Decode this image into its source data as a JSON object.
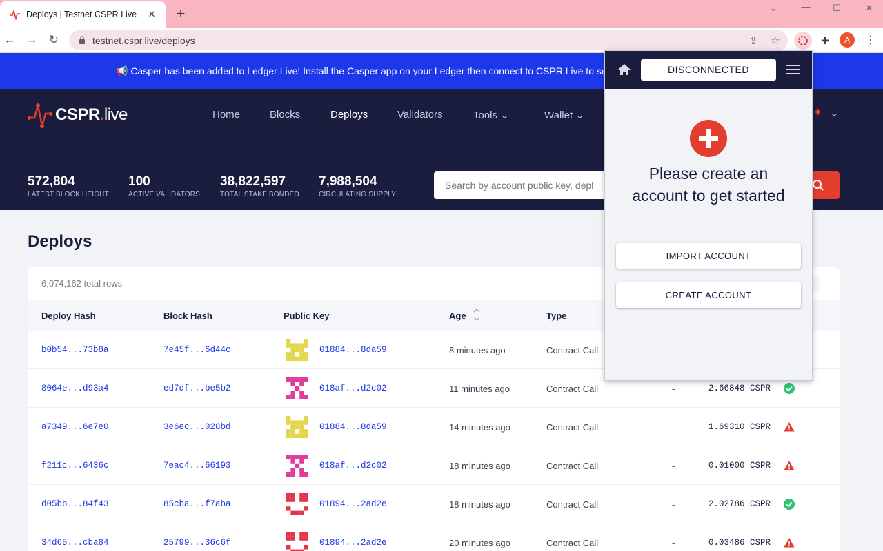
{
  "browser": {
    "tab_title": "Deploys | Testnet CSPR Live",
    "tab_close": "✕",
    "new_tab": "+",
    "url": "testnet.cspr.live/deploys",
    "profile_initial": "A"
  },
  "announcement": {
    "text": "📢 Casper has been added to Ledger Live! Install the Casper app on your Ledger then connect to CSPR.Live to secu"
  },
  "header": {
    "logo_main": "CSPR",
    "logo_dot": ".",
    "logo_live": "live",
    "nav": [
      "Home",
      "Blocks",
      "Deploys",
      "Validators",
      "Tools",
      "Wallet"
    ],
    "stats": [
      {
        "value": "572,804",
        "label": "LATEST BLOCK HEIGHT"
      },
      {
        "value": "100",
        "label": "ACTIVE VALIDATORS"
      },
      {
        "value": "38,822,597",
        "label": "TOTAL STAKE BONDED"
      },
      {
        "value": "7,988,504",
        "label": "CIRCULATING SUPPLY"
      }
    ],
    "search_placeholder": "Search by account public key, depl"
  },
  "main": {
    "title": "Deploys",
    "total_rows": "6,074,162 total rows",
    "partial_badge": "st",
    "columns": [
      "Deploy Hash",
      "Block Hash",
      "Public Key",
      "Age",
      "Type"
    ],
    "rows": [
      {
        "deploy": "b0b54...73b8a",
        "block": "7e45f...6d44c",
        "key": "01884...8da59",
        "age": "8 minutes ago",
        "type": "Contract Call",
        "dash": "",
        "amount": "",
        "status": "",
        "identicon": "yellow"
      },
      {
        "deploy": "8064e...d93a4",
        "block": "ed7df...be5b2",
        "key": "018af...d2c02",
        "age": "11 minutes ago",
        "type": "Contract Call",
        "dash": "-",
        "amount": "2.66848 CSPR",
        "status": "success",
        "identicon": "pink"
      },
      {
        "deploy": "a7349...6e7e0",
        "block": "3e6ec...028bd",
        "key": "01884...8da59",
        "age": "14 minutes ago",
        "type": "Contract Call",
        "dash": "-",
        "amount": "1.69310 CSPR",
        "status": "error",
        "identicon": "yellow"
      },
      {
        "deploy": "f211c...6436c",
        "block": "7eac4...66193",
        "key": "018af...d2c02",
        "age": "18 minutes ago",
        "type": "Contract Call",
        "dash": "-",
        "amount": "0.01000 CSPR",
        "status": "error",
        "identicon": "pink"
      },
      {
        "deploy": "d05bb...84f43",
        "block": "85cba...f7aba",
        "key": "01894...2ad2e",
        "age": "18 minutes ago",
        "type": "Contract Call",
        "dash": "-",
        "amount": "2.02786 CSPR",
        "status": "success",
        "identicon": "red"
      },
      {
        "deploy": "34d65...cba84",
        "block": "25799...36c6f",
        "key": "01894...2ad2e",
        "age": "20 minutes ago",
        "type": "Contract Call",
        "dash": "-",
        "amount": "0.03486 CSPR",
        "status": "error",
        "identicon": "red"
      }
    ]
  },
  "popup": {
    "status": "DISCONNECTED",
    "message_line1": "Please create an",
    "message_line2": "account to get started",
    "import_label": "IMPORT ACCOUNT",
    "create_label": "CREATE ACCOUNT"
  },
  "colors": {
    "accent_red": "#e33d2e",
    "brand_blue": "#1c38e8",
    "header_navy": "#1a1d3e",
    "success_green": "#2fc46f",
    "identicon_yellow": "#e3d54c",
    "identicon_pink": "#e23ba0",
    "identicon_red": "#e5354d"
  }
}
